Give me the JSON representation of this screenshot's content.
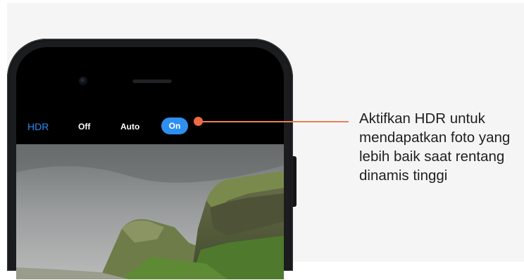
{
  "camera_ui": {
    "hdr_label": "HDR",
    "options": [
      "Off",
      "Auto",
      "On"
    ],
    "selected": "On"
  },
  "callout": {
    "lines": [
      "Aktifkan HDR untuk",
      "mendapatkan foto yang",
      "lebih baik saat rentang",
      "dinamis tinggi"
    ]
  },
  "colors": {
    "accent": "#2f8ff0",
    "callout": "#ef6a43"
  }
}
